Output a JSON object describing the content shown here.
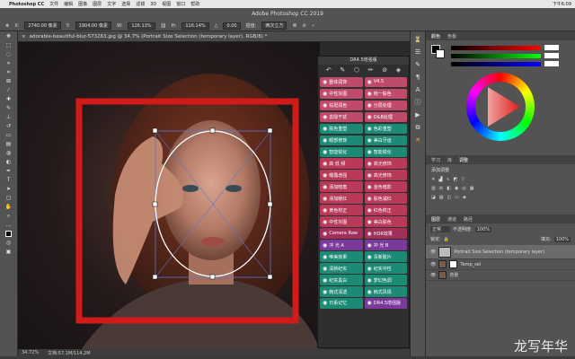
{
  "menubar": {
    "apple": "",
    "app_name": "Photoshop CC",
    "items": [
      "文件",
      "编辑",
      "图像",
      "图层",
      "文字",
      "选择",
      "滤镜",
      "3D",
      "视图",
      "窗口",
      "帮助"
    ],
    "clock": "下午6:09"
  },
  "window_title": "Adobe Photoshop CC 2019",
  "options": {
    "x_label": "X:",
    "x_value": "2740.00 像素",
    "y_label": "Y:",
    "y_value": "1904.00 像素",
    "w_label": "W:",
    "w_value": "126.13%",
    "h_label": "H:",
    "h_value": "116.14%",
    "angle_label": "△",
    "angle_value": "0.00",
    "interp_label": "插值:",
    "interp_value": "两次立方"
  },
  "doc_tab": {
    "close": "×",
    "title": "adorable-beautiful-blur-573263.jpg @ 34.7% (Portrait Size Selection (temporary layer), RGB/8) *"
  },
  "plugin": {
    "title": "DR4.5增强版",
    "header_icons": [
      "↶",
      "✎",
      "⬡",
      "✏",
      "⊘",
      "◈"
    ],
    "header_version": "V4.5",
    "rows": [
      [
        {
          "label": "整体润饰",
          "color": "#c04a6a"
        },
        {
          "label": "V4.5",
          "color": "#c04a6a"
        }
      ],
      [
        {
          "label": "中性灰图",
          "color": "#c04a6a"
        },
        {
          "label": "统一肤色",
          "color": "#c04a6a"
        }
      ],
      [
        {
          "label": "祛斑润色",
          "color": "#c04a6a"
        },
        {
          "label": "分层处理",
          "color": "#c04a6a"
        }
      ],
      [
        {
          "label": "去除干扰",
          "color": "#c04a6a"
        },
        {
          "label": "D&B处理",
          "color": "#c04a6a"
        }
      ],
      [
        {
          "label": "肤色重塑",
          "color": "#1d8a76"
        },
        {
          "label": "色彩重塑",
          "color": "#1d8a76"
        }
      ],
      [
        {
          "label": "眼部修饰",
          "color": "#1d8a76"
        },
        {
          "label": "美白牙齿",
          "color": "#1d8a76"
        }
      ],
      [
        {
          "label": "智能锐化",
          "color": "#1d8a76"
        },
        {
          "label": "智能锐化",
          "color": "#1d8a76"
        }
      ],
      [
        {
          "label": "高 低 频",
          "color": "#b83a58"
        },
        {
          "label": "高光修饰",
          "color": "#b83a58"
        }
      ],
      [
        {
          "label": "曝露增强",
          "color": "#b83a58"
        },
        {
          "label": "高光修饰",
          "color": "#b83a58"
        }
      ],
      [
        {
          "label": "添加暗角",
          "color": "#b83a58"
        },
        {
          "label": "金色暗影",
          "color": "#b83a58"
        }
      ],
      [
        {
          "label": "添加暖红",
          "color": "#b83a58"
        },
        {
          "label": "肤色减红",
          "color": "#b83a58"
        }
      ],
      [
        {
          "label": "黄色校正",
          "color": "#b83a58"
        },
        {
          "label": "红色校正",
          "color": "#b83a58"
        }
      ],
      [
        {
          "label": "中性灰图",
          "color": "#b83a58"
        },
        {
          "label": "美白肤色",
          "color": "#b83a58"
        }
      ],
      [
        {
          "label": "Camera Raw",
          "color": "#a0305a"
        },
        {
          "label": "HDR效果",
          "color": "#a0305a"
        }
      ],
      [
        {
          "label": "冲 光 A",
          "color": "#7a3a9a"
        },
        {
          "label": "冲 光 B",
          "color": "#7a3a9a"
        }
      ],
      [
        {
          "label": "唯美效果",
          "color": "#1d8a76"
        },
        {
          "label": "清新胶片",
          "color": "#1d8a76"
        }
      ],
      [
        {
          "label": "清新纪实",
          "color": "#1d8a76"
        },
        {
          "label": "纪实中性",
          "color": "#1d8a76"
        }
      ],
      [
        {
          "label": "纪实黑白",
          "color": "#1d8a76"
        },
        {
          "label": "梦幻色调",
          "color": "#1d8a76"
        }
      ],
      [
        {
          "label": "韩式清透",
          "color": "#1d8a76"
        },
        {
          "label": "韩式风情",
          "color": "#1d8a76"
        }
      ],
      [
        {
          "label": "日系记忆",
          "color": "#1d8a76"
        },
        {
          "label": "DR4.5增强版",
          "color": "#7a3a9a"
        }
      ]
    ]
  },
  "status": {
    "zoom": "34.72%",
    "doc": "文档:57.1M/114.2M"
  },
  "right": {
    "color_tabs": [
      "颜色",
      "色板"
    ],
    "lib_tabs": [
      "学习",
      "库",
      "调整"
    ],
    "adj_label": "添加调整",
    "layer_tabs": [
      "图层",
      "通道",
      "路径"
    ],
    "blend_mode": "正常",
    "opacity_label": "不透明度:",
    "opacity_value": "100%",
    "fill_label": "填充:",
    "fill_value": "100%",
    "lock_label": "锁定:",
    "layers": [
      {
        "name": "Portrait Size Selection (temporary layer)"
      },
      {
        "name": "Temp_sel"
      },
      {
        "name": "背景"
      }
    ]
  },
  "watermark": "龙写年华",
  "colors": {
    "ui_dark": "#535353",
    "selection_red": "#d11a1a",
    "accent_pink": "#c04a6a",
    "accent_teal": "#1d8a76",
    "accent_purple": "#7a3a9a"
  }
}
